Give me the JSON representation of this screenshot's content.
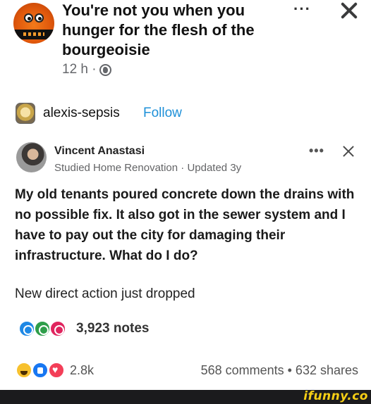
{
  "fb_post": {
    "title": "You're not you when you hunger for the flesh of the bourgeoisie",
    "meta": "12 h ·",
    "more": "···"
  },
  "tumblr": {
    "username": "alexis-sepsis",
    "follow_label": "Follow"
  },
  "quora": {
    "author": "Vincent Anastasi",
    "credential": "Studied Home Renovation · Updated 3y",
    "more": "•••",
    "body": "My old tenants poured concrete down the drains with no possible fix. It also got in the sewer system and I have to pay out the city for damaging their infrastructure. What do I do?"
  },
  "caption": "New direct action just dropped",
  "notes": {
    "count": "3,923 notes"
  },
  "reactions": {
    "count": "2.8k",
    "comments_shares": "568 comments • 632 shares"
  },
  "watermark": "ifunny.co",
  "colors": {
    "follow_blue": "#1e90d8",
    "footer_bg": "#1b1b1d",
    "watermark_yellow": "#f7cf15"
  },
  "icons": {
    "fb_avatar": "mascot-avatar-icon",
    "globe": "globe-icon",
    "notes": [
      "reply-icon",
      "reblog-icon",
      "heart-icon"
    ],
    "reactions": [
      "haha-icon",
      "like-icon",
      "love-icon"
    ]
  }
}
